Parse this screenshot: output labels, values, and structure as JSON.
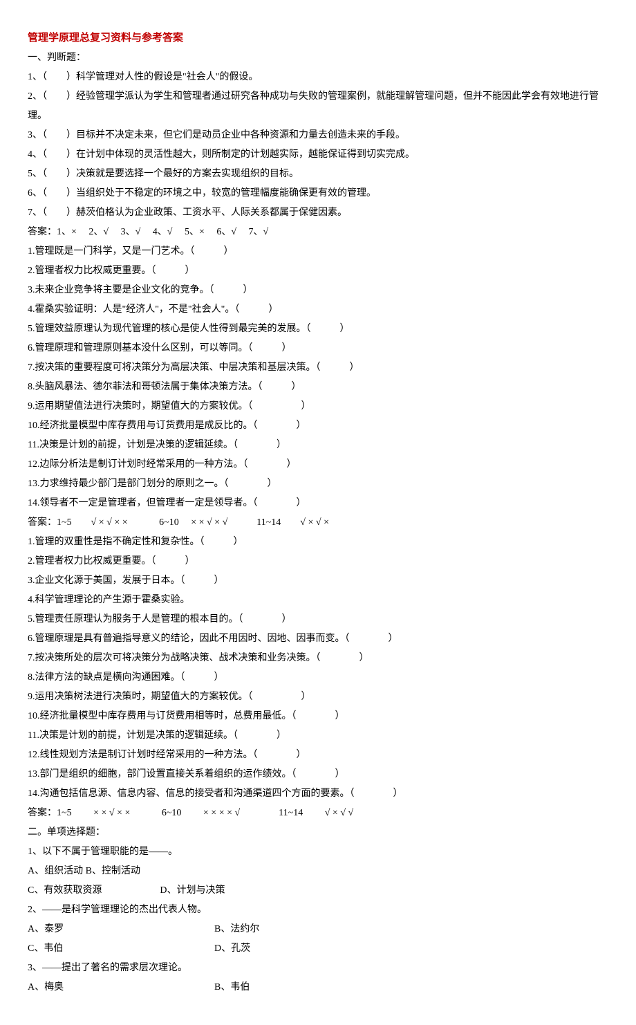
{
  "title": "管理学原理总复习资料与参考答案",
  "section1_header": "一、判断题：",
  "tf_q1": "1、（　　）科学管理对人性的假设是\"社会人\"的假设。",
  "tf_q2": "2、（　　）经验管理学派认为学生和管理者通过研究各种成功与失败的管理案例，就能理解管理问题，但并不能因此学会有效地进行管理。",
  "tf_q3": "3、（　　）目标并不决定未来，但它们是动员企业中各种资源和力量去创造未来的手段。",
  "tf_q4": "4、（　　）在计划中体现的灵活性越大，则所制定的计划越实际，越能保证得到切实完成。",
  "tf_q5": "5、（　　）决策就是要选择一个最好的方案去实现组织的目标。",
  "tf_q6": "6、（　　）当组织处于不稳定的环境之中，较宽的管理幅度能确保更有效的管理。",
  "tf_q7": "7、（　　）赫茨伯格认为企业政策、工资水平、人际关系都属于保健因素。",
  "tf_ans1": "答案：1、×　 2、√　 3、√　 4、√　 5、×　 6、√　 7、√",
  "g1_q1": "1.管理既是一门科学，又是一门艺术。（　　　）",
  "g1_q2": "2.管理者权力比权威更重要。（　　　）",
  "g1_q3": "3.未来企业竞争将主要是企业文化的竞争。（　　　）",
  "g1_q4": "4.霍桑实验证明：人是\"经济人\"，不是\"社会人\"。（　　　）",
  "g1_q5": "5.管理效益原理认为现代管理的核心是使人性得到最完美的发展。（　　　）",
  "g1_q6": "6.管理原理和管理原则基本没什么区别，可以等同。（　　　）",
  "g1_q7": "7.按决策的重要程度可将决策分为高层决策、中层决策和基层决策。（　　　）",
  "g1_q8": "8.头脑风暴法、德尔菲法和哥顿法属于集体决策方法。（　　　）",
  "g1_q9": "9.运用期望值法进行决策时，期望值大的方案较优。（　　　　　）",
  "g1_q10": "10.经济批量模型中库存费用与订货费用是成反比的。（　　　　）",
  "g1_q11": "11.决策是计划的前提，计划是决策的逻辑延续。（　　　　）",
  "g1_q12": "12.边际分析法是制订计划时经常采用的一种方法。（　　　　）",
  "g1_q13": "13.力求维持最少部门是部门划分的原则之一。（　　　　）",
  "g1_q14": "14.领导者不一定是管理者，但管理者一定是领导者。（　　　　）",
  "g1_ans": "答案：1~5　　√ × √ × ×　　　 6~10　 × × √ × √　　　11~14　　√ × √ ×",
  "g2_q1": "1.管理的双重性是指不确定性和复杂性。（　　　）",
  "g2_q2": "2.管理者权力比权威更重要。（　　　）",
  "g2_q3": "3.企业文化源于美国，发展于日本。（　　　）",
  "g2_q4": "4.科学管理理论的产生源于霍桑实验。",
  "g2_q5": "5.管理责任原理认为服务于人是管理的根本目的。（　　　　）",
  "g2_q6": "6.管理原理是具有普遍指导意义的结论，因此不用因时、因地、因事而变。（　　　　）",
  "g2_q7": "7.按决策所处的层次可将决策分为战略决策、战术决策和业务决策。（　　　　）",
  "g2_q8": "8.法律方法的缺点是横向沟通困难。（　　　）",
  "g2_q9": "9.运用决策树法进行决策时，期望值大的方案较优。（　　　　　）",
  "g2_q10": "10.经济批量模型中库存费用与订货费用相等时，总费用最低。（　　　　）",
  "g2_q11": "11.决策是计划的前提，计划是决策的逻辑延续。（　　　　）",
  "g2_q12": "12.线性规划方法是制订计划时经常采用的一种方法。（　　　　）",
  "g2_q13": "13.部门是组织的细胞，部门设置直接关系着组织的运作绩效。（　　　　）",
  "g2_q14": "14.沟通包括信息源、信息内容、信息的接受者和沟通渠道四个方面的要素。（　　　　）",
  "g2_ans": "答案：1~5　　 × × √ × ×　　　 6~10　　 × × × × √　　　　11~14　　 √ × √ √",
  "section2_header": "二。单项选择题：",
  "mc_q1": "1、以下不属于管理职能的是——。",
  "mc_q1_ab": "A、组织活动 B、控制活动",
  "mc_q1_cd": "C、有效获取资源　　　　　　D、计划与决策",
  "mc_q2": "2、——是科学管理理论的杰出代表人物。",
  "mc_q2_a": "A、泰罗",
  "mc_q2_b": "B、法约尔",
  "mc_q2_c": "C、韦伯",
  "mc_q2_d": "D、孔茨",
  "mc_q3": "3、——提出了著名的需求层次理论。",
  "mc_q3_a": "A、梅奥",
  "mc_q3_b": "B、韦伯"
}
